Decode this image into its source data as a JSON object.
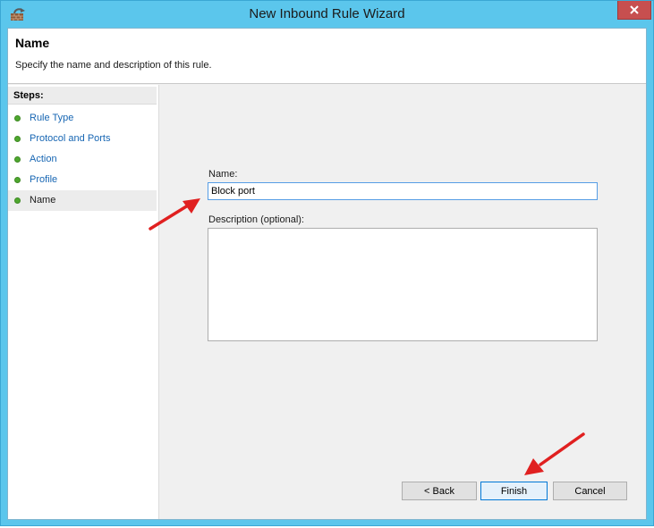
{
  "window": {
    "title": "New Inbound Rule Wizard",
    "icon": "firewall-wizard-icon",
    "close_icon": "close-icon",
    "accent_color": "#5bc6ec"
  },
  "header": {
    "title": "Name",
    "description": "Specify the name and description of this rule."
  },
  "steps": {
    "heading": "Steps:",
    "items": [
      {
        "label": "Rule Type"
      },
      {
        "label": "Protocol and Ports"
      },
      {
        "label": "Action"
      },
      {
        "label": "Profile"
      },
      {
        "label": "Name"
      }
    ],
    "current": "Name"
  },
  "form": {
    "name_label": "Name:",
    "name_value": "Block port",
    "description_label": "Description (optional):",
    "description_value": ""
  },
  "buttons": {
    "back": "< Back",
    "finish": "Finish",
    "cancel": "Cancel"
  },
  "annotation_color": "#e02020"
}
